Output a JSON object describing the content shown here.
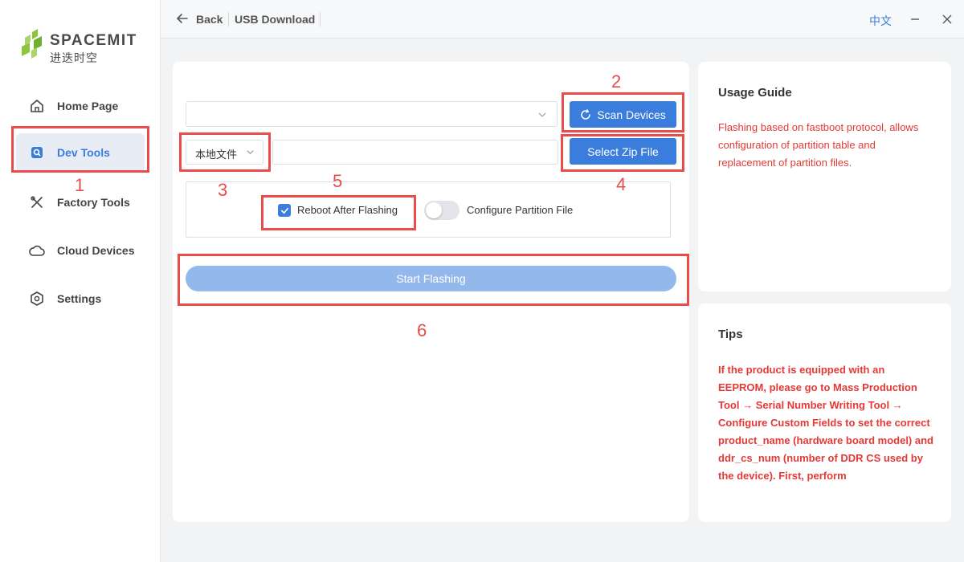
{
  "brand": {
    "name": "SPACEMIT",
    "subtitle": "进迭时空",
    "colors": {
      "green": "#8cc63f",
      "accent": "#3b7ddd",
      "annotation": "#ea4b4b"
    }
  },
  "sidebar": {
    "items": [
      {
        "label": "Home Page",
        "icon": "home-icon"
      },
      {
        "label": "Dev Tools",
        "icon": "dev-tools-icon",
        "active": true
      },
      {
        "label": "Factory Tools",
        "icon": "tools-icon"
      },
      {
        "label": "Cloud Devices",
        "icon": "cloud-icon"
      },
      {
        "label": "Settings",
        "icon": "settings-icon"
      }
    ]
  },
  "titlebar": {
    "back_label": "Back",
    "page_title": "USB Download",
    "language": "中文"
  },
  "main": {
    "device_select_value": "",
    "scan_button_label": "Scan Devices",
    "source_select_value": "本地文件",
    "zip_input_value": "",
    "select_zip_button_label": "Select Zip File",
    "reboot_checkbox": {
      "label": "Reboot After Flashing",
      "checked": true
    },
    "partition_toggle": {
      "label": "Configure Partition File",
      "on": false
    },
    "start_button_label": "Start Flashing"
  },
  "usage_guide": {
    "title": "Usage Guide",
    "body": "Flashing based on fastboot protocol, allows configuration of partition table and replacement of partition files."
  },
  "tips": {
    "title": "Tips",
    "body": "If the product is equipped with an EEPROM, please go to Mass Production Tool → Serial Number Writing Tool → Configure Custom Fields to set the correct product_name (hardware board model) and ddr_cs_num (number of DDR CS used by the device). First, perform"
  },
  "annotations": [
    "1",
    "2",
    "3",
    "4",
    "5",
    "6"
  ]
}
